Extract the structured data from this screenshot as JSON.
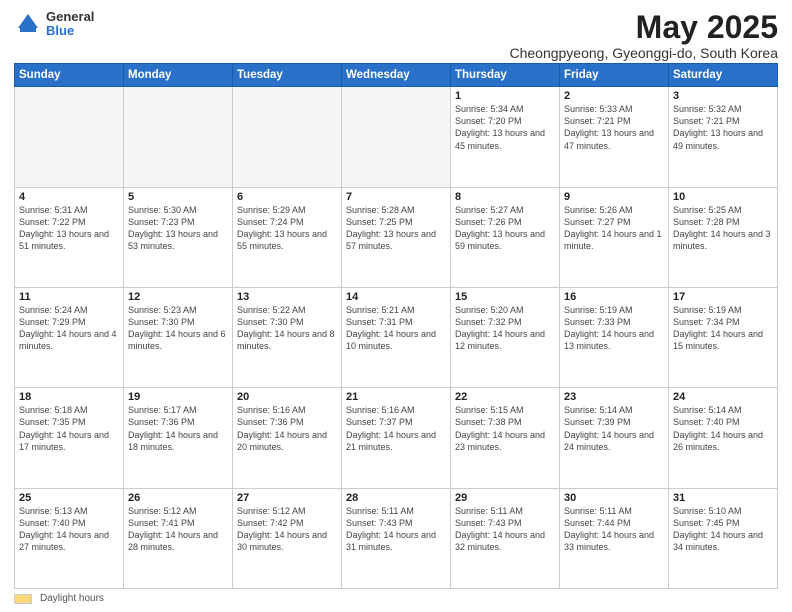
{
  "logo": {
    "general": "General",
    "blue": "Blue"
  },
  "title": "May 2025",
  "location": "Cheongpyeong, Gyeonggi-do, South Korea",
  "days_of_week": [
    "Sunday",
    "Monday",
    "Tuesday",
    "Wednesday",
    "Thursday",
    "Friday",
    "Saturday"
  ],
  "footer": {
    "label": "Daylight hours"
  },
  "weeks": [
    [
      {
        "day": "",
        "info": "",
        "empty": true
      },
      {
        "day": "",
        "info": "",
        "empty": true
      },
      {
        "day": "",
        "info": "",
        "empty": true
      },
      {
        "day": "",
        "info": "",
        "empty": true
      },
      {
        "day": "1",
        "info": "Sunrise: 5:34 AM\nSunset: 7:20 PM\nDaylight: 13 hours\nand 45 minutes."
      },
      {
        "day": "2",
        "info": "Sunrise: 5:33 AM\nSunset: 7:21 PM\nDaylight: 13 hours\nand 47 minutes."
      },
      {
        "day": "3",
        "info": "Sunrise: 5:32 AM\nSunset: 7:21 PM\nDaylight: 13 hours\nand 49 minutes."
      }
    ],
    [
      {
        "day": "4",
        "info": "Sunrise: 5:31 AM\nSunset: 7:22 PM\nDaylight: 13 hours\nand 51 minutes."
      },
      {
        "day": "5",
        "info": "Sunrise: 5:30 AM\nSunset: 7:23 PM\nDaylight: 13 hours\nand 53 minutes."
      },
      {
        "day": "6",
        "info": "Sunrise: 5:29 AM\nSunset: 7:24 PM\nDaylight: 13 hours\nand 55 minutes."
      },
      {
        "day": "7",
        "info": "Sunrise: 5:28 AM\nSunset: 7:25 PM\nDaylight: 13 hours\nand 57 minutes."
      },
      {
        "day": "8",
        "info": "Sunrise: 5:27 AM\nSunset: 7:26 PM\nDaylight: 13 hours\nand 59 minutes."
      },
      {
        "day": "9",
        "info": "Sunrise: 5:26 AM\nSunset: 7:27 PM\nDaylight: 14 hours\nand 1 minute."
      },
      {
        "day": "10",
        "info": "Sunrise: 5:25 AM\nSunset: 7:28 PM\nDaylight: 14 hours\nand 3 minutes."
      }
    ],
    [
      {
        "day": "11",
        "info": "Sunrise: 5:24 AM\nSunset: 7:29 PM\nDaylight: 14 hours\nand 4 minutes."
      },
      {
        "day": "12",
        "info": "Sunrise: 5:23 AM\nSunset: 7:30 PM\nDaylight: 14 hours\nand 6 minutes."
      },
      {
        "day": "13",
        "info": "Sunrise: 5:22 AM\nSunset: 7:30 PM\nDaylight: 14 hours\nand 8 minutes."
      },
      {
        "day": "14",
        "info": "Sunrise: 5:21 AM\nSunset: 7:31 PM\nDaylight: 14 hours\nand 10 minutes."
      },
      {
        "day": "15",
        "info": "Sunrise: 5:20 AM\nSunset: 7:32 PM\nDaylight: 14 hours\nand 12 minutes."
      },
      {
        "day": "16",
        "info": "Sunrise: 5:19 AM\nSunset: 7:33 PM\nDaylight: 14 hours\nand 13 minutes."
      },
      {
        "day": "17",
        "info": "Sunrise: 5:19 AM\nSunset: 7:34 PM\nDaylight: 14 hours\nand 15 minutes."
      }
    ],
    [
      {
        "day": "18",
        "info": "Sunrise: 5:18 AM\nSunset: 7:35 PM\nDaylight: 14 hours\nand 17 minutes."
      },
      {
        "day": "19",
        "info": "Sunrise: 5:17 AM\nSunset: 7:36 PM\nDaylight: 14 hours\nand 18 minutes."
      },
      {
        "day": "20",
        "info": "Sunrise: 5:16 AM\nSunset: 7:36 PM\nDaylight: 14 hours\nand 20 minutes."
      },
      {
        "day": "21",
        "info": "Sunrise: 5:16 AM\nSunset: 7:37 PM\nDaylight: 14 hours\nand 21 minutes."
      },
      {
        "day": "22",
        "info": "Sunrise: 5:15 AM\nSunset: 7:38 PM\nDaylight: 14 hours\nand 23 minutes."
      },
      {
        "day": "23",
        "info": "Sunrise: 5:14 AM\nSunset: 7:39 PM\nDaylight: 14 hours\nand 24 minutes."
      },
      {
        "day": "24",
        "info": "Sunrise: 5:14 AM\nSunset: 7:40 PM\nDaylight: 14 hours\nand 26 minutes."
      }
    ],
    [
      {
        "day": "25",
        "info": "Sunrise: 5:13 AM\nSunset: 7:40 PM\nDaylight: 14 hours\nand 27 minutes."
      },
      {
        "day": "26",
        "info": "Sunrise: 5:12 AM\nSunset: 7:41 PM\nDaylight: 14 hours\nand 28 minutes."
      },
      {
        "day": "27",
        "info": "Sunrise: 5:12 AM\nSunset: 7:42 PM\nDaylight: 14 hours\nand 30 minutes."
      },
      {
        "day": "28",
        "info": "Sunrise: 5:11 AM\nSunset: 7:43 PM\nDaylight: 14 hours\nand 31 minutes."
      },
      {
        "day": "29",
        "info": "Sunrise: 5:11 AM\nSunset: 7:43 PM\nDaylight: 14 hours\nand 32 minutes."
      },
      {
        "day": "30",
        "info": "Sunrise: 5:11 AM\nSunset: 7:44 PM\nDaylight: 14 hours\nand 33 minutes."
      },
      {
        "day": "31",
        "info": "Sunrise: 5:10 AM\nSunset: 7:45 PM\nDaylight: 14 hours\nand 34 minutes."
      }
    ]
  ]
}
